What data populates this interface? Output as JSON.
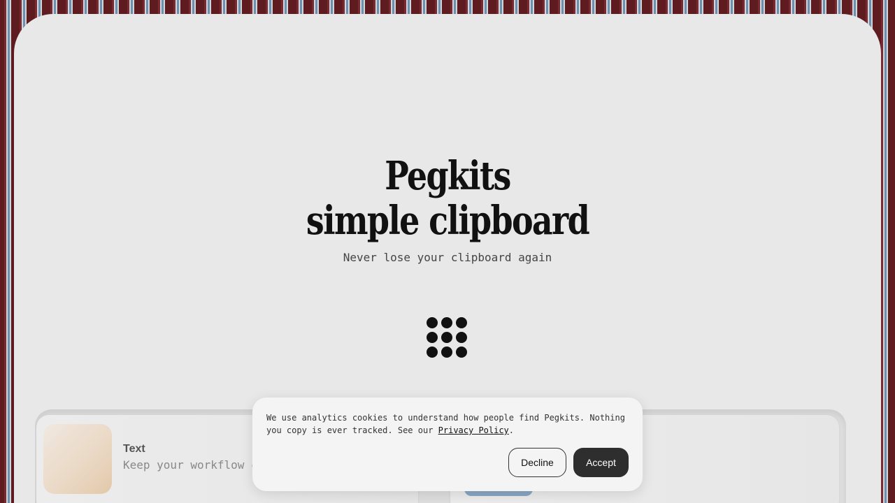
{
  "hero": {
    "title_line1": "Pegkits",
    "title_line2": "simple clipboard",
    "tagline": "Never lose your clipboard again"
  },
  "logo": {
    "icon": "nine-dot-grid-icon"
  },
  "clipboard_preview": {
    "items": [
      {
        "kind": "Text",
        "description": "Keep your workflow c"
      },
      {
        "kind": "",
        "description": ""
      }
    ]
  },
  "cookie_banner": {
    "message": "We use analytics cookies to understand how people find Pegkits. Nothing you copy is ever tracked. See our ",
    "privacy_link": "Privacy Policy",
    "trailing": ".",
    "decline_label": "Decline",
    "accept_label": "Accept"
  },
  "colors": {
    "card_background": "#e8e8e8",
    "accept_button": "#2e2e2e",
    "title_text": "#111111"
  }
}
